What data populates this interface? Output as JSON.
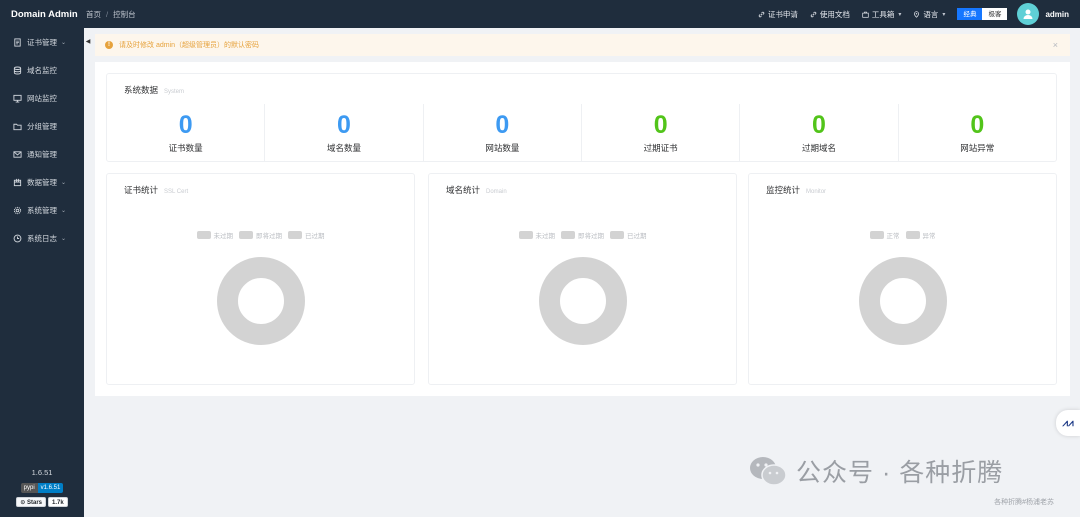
{
  "app": {
    "title": "Domain Admin",
    "version": "1.6.51"
  },
  "breadcrumb": {
    "home": "首页",
    "separator": "/",
    "current": "控制台"
  },
  "topnav": {
    "cert_apply": "证书申请",
    "docs": "使用文档",
    "toolbox": "工具箱",
    "language": "语言",
    "theme_classic": "经典",
    "theme_simple": "极客",
    "username": "admin"
  },
  "sidebar": {
    "items": [
      {
        "label": "证书管理",
        "icon": "document-icon",
        "has_arrow": true
      },
      {
        "label": "域名监控",
        "icon": "database-icon",
        "has_arrow": false
      },
      {
        "label": "网站监控",
        "icon": "monitor-icon",
        "has_arrow": false
      },
      {
        "label": "分组管理",
        "icon": "folder-icon",
        "has_arrow": false
      },
      {
        "label": "通知管理",
        "icon": "mail-icon",
        "has_arrow": false
      },
      {
        "label": "数据管理",
        "icon": "box-icon",
        "has_arrow": true
      },
      {
        "label": "系统管理",
        "icon": "gear-icon",
        "has_arrow": true
      },
      {
        "label": "系统日志",
        "icon": "clock-icon",
        "has_arrow": true
      }
    ],
    "badges": {
      "pypi_label": "pypi",
      "pypi_version": "v1.6.51",
      "github_label": "Stars",
      "github_count": "1.7k"
    }
  },
  "alert": {
    "text": "请及时修改 admin（超级管理员）的默认密码"
  },
  "system_data": {
    "title": "系统数据",
    "subtitle": "System",
    "stats": [
      {
        "label": "证书数量",
        "value": "0",
        "color": "#3d9af2"
      },
      {
        "label": "域名数量",
        "value": "0",
        "color": "#3d9af2"
      },
      {
        "label": "网站数量",
        "value": "0",
        "color": "#3d9af2"
      },
      {
        "label": "过期证书",
        "value": "0",
        "color": "#52c41a"
      },
      {
        "label": "过期域名",
        "value": "0",
        "color": "#52c41a"
      },
      {
        "label": "网站异常",
        "value": "0",
        "color": "#52c41a"
      }
    ]
  },
  "charts": [
    {
      "title": "证书统计",
      "subtitle": "SSL Cert",
      "legend": [
        "未过期",
        "即将过期",
        "已过期"
      ]
    },
    {
      "title": "域名统计",
      "subtitle": "Domain",
      "legend": [
        "未过期",
        "即将过期",
        "已过期"
      ]
    },
    {
      "title": "监控统计",
      "subtitle": "Monitor",
      "legend": [
        "正常",
        "异常"
      ]
    }
  ],
  "watermark": {
    "text": "公众号 · 各种折腾",
    "subtext": "各种折腾#杨浦老苏"
  }
}
